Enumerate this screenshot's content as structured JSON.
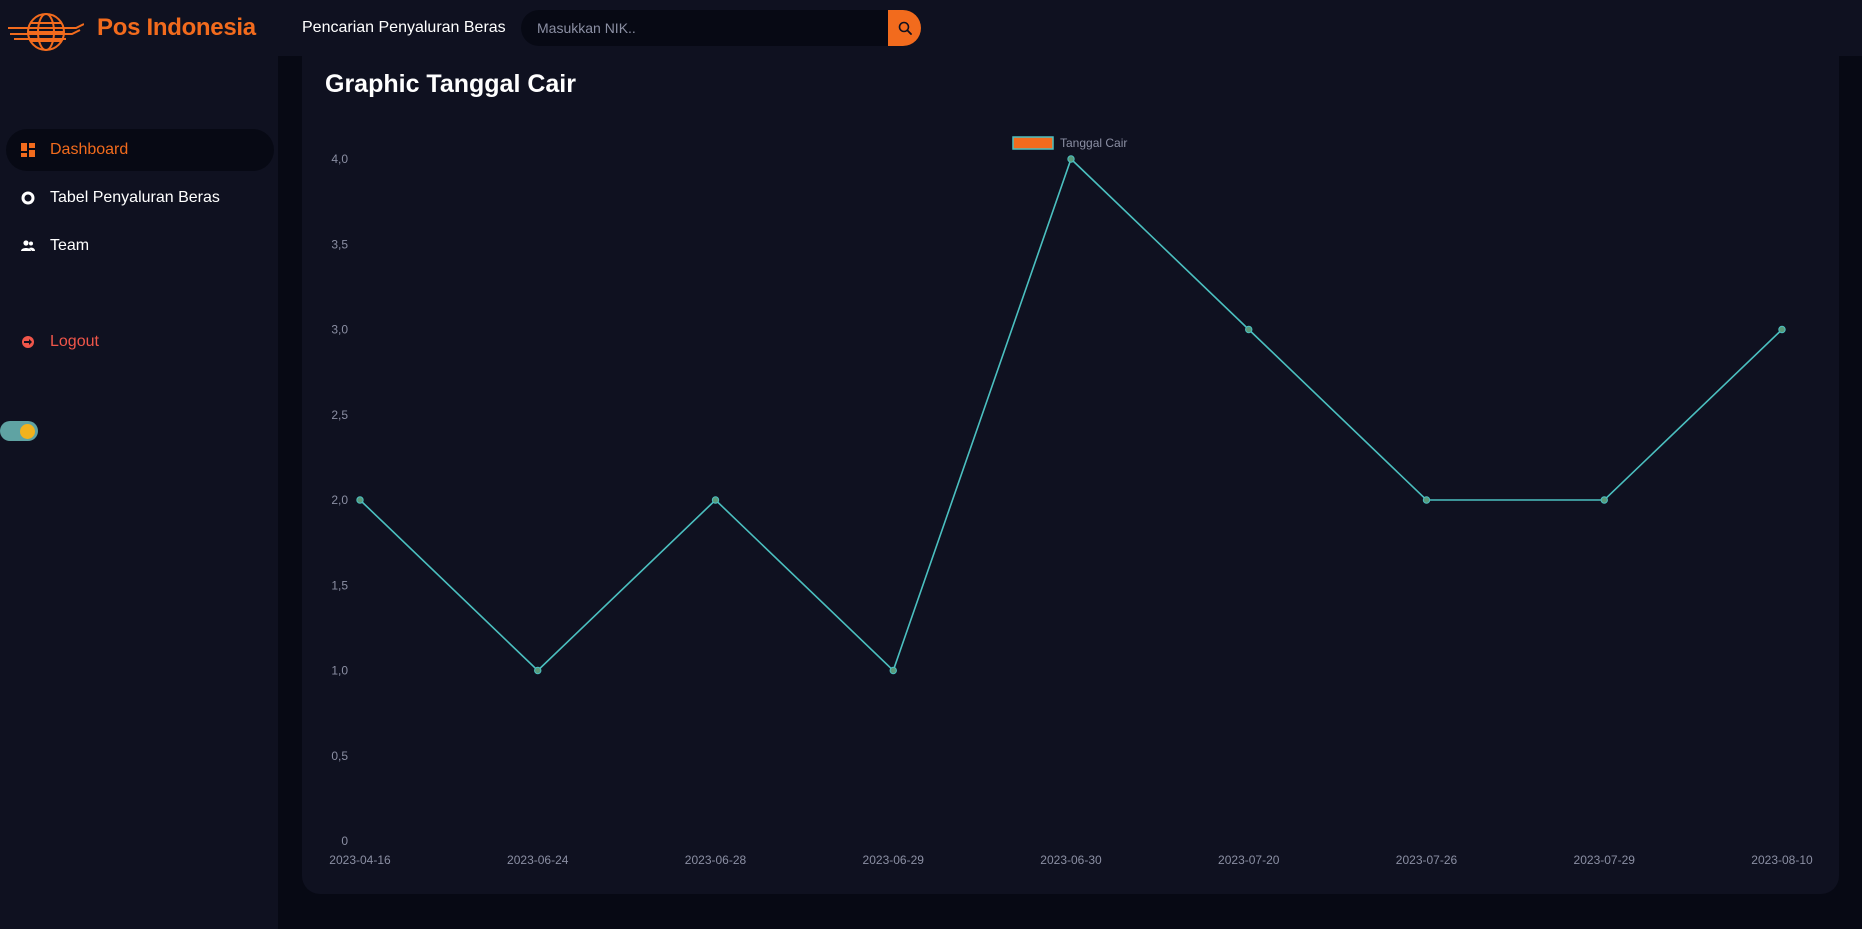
{
  "header": {
    "brand": "Pos Indonesia",
    "search_label": "Pencarian Penyaluran Beras",
    "search_placeholder": "Masukkan NIK..",
    "search_icon": "search-icon",
    "logo": "pos-indonesia-logo"
  },
  "sidebar": {
    "items": [
      {
        "label": "Dashboard",
        "icon": "dashboard-icon",
        "active": true
      },
      {
        "label": "Tabel Penyaluran Beras",
        "icon": "donut-chart-icon",
        "active": false
      },
      {
        "label": "Team",
        "icon": "team-icon",
        "active": false
      }
    ],
    "logout": {
      "label": "Logout",
      "icon": "logout-icon"
    },
    "theme_toggle": {
      "icon": "theme-toggle-icon"
    }
  },
  "colors": {
    "accent": "#f26b1d",
    "background": "#0f1120",
    "panel": "#070914",
    "line": "#4bc0c0",
    "logout": "#f0564a"
  },
  "main": {
    "title": "Graphic Tanggal Cair"
  },
  "chart_data": {
    "type": "line",
    "title": "",
    "xlabel": "",
    "ylabel": "",
    "categories": [
      "2023-04-16",
      "2023-06-24",
      "2023-06-28",
      "2023-06-29",
      "2023-06-30",
      "2023-07-20",
      "2023-07-26",
      "2023-07-29",
      "2023-08-10"
    ],
    "series": [
      {
        "name": "Tanggal Cair",
        "values": [
          2,
          1,
          2,
          1,
          4,
          3,
          2,
          2,
          3
        ],
        "color": "#4bc0c0",
        "legend_fill": "#f26b1d"
      }
    ],
    "ylim": [
      0,
      4
    ],
    "yticks": [
      "0",
      "0,5",
      "1,0",
      "1,5",
      "2,0",
      "2,5",
      "3,0",
      "3,5",
      "4,0"
    ],
    "legend": "top-center",
    "grid": false
  }
}
